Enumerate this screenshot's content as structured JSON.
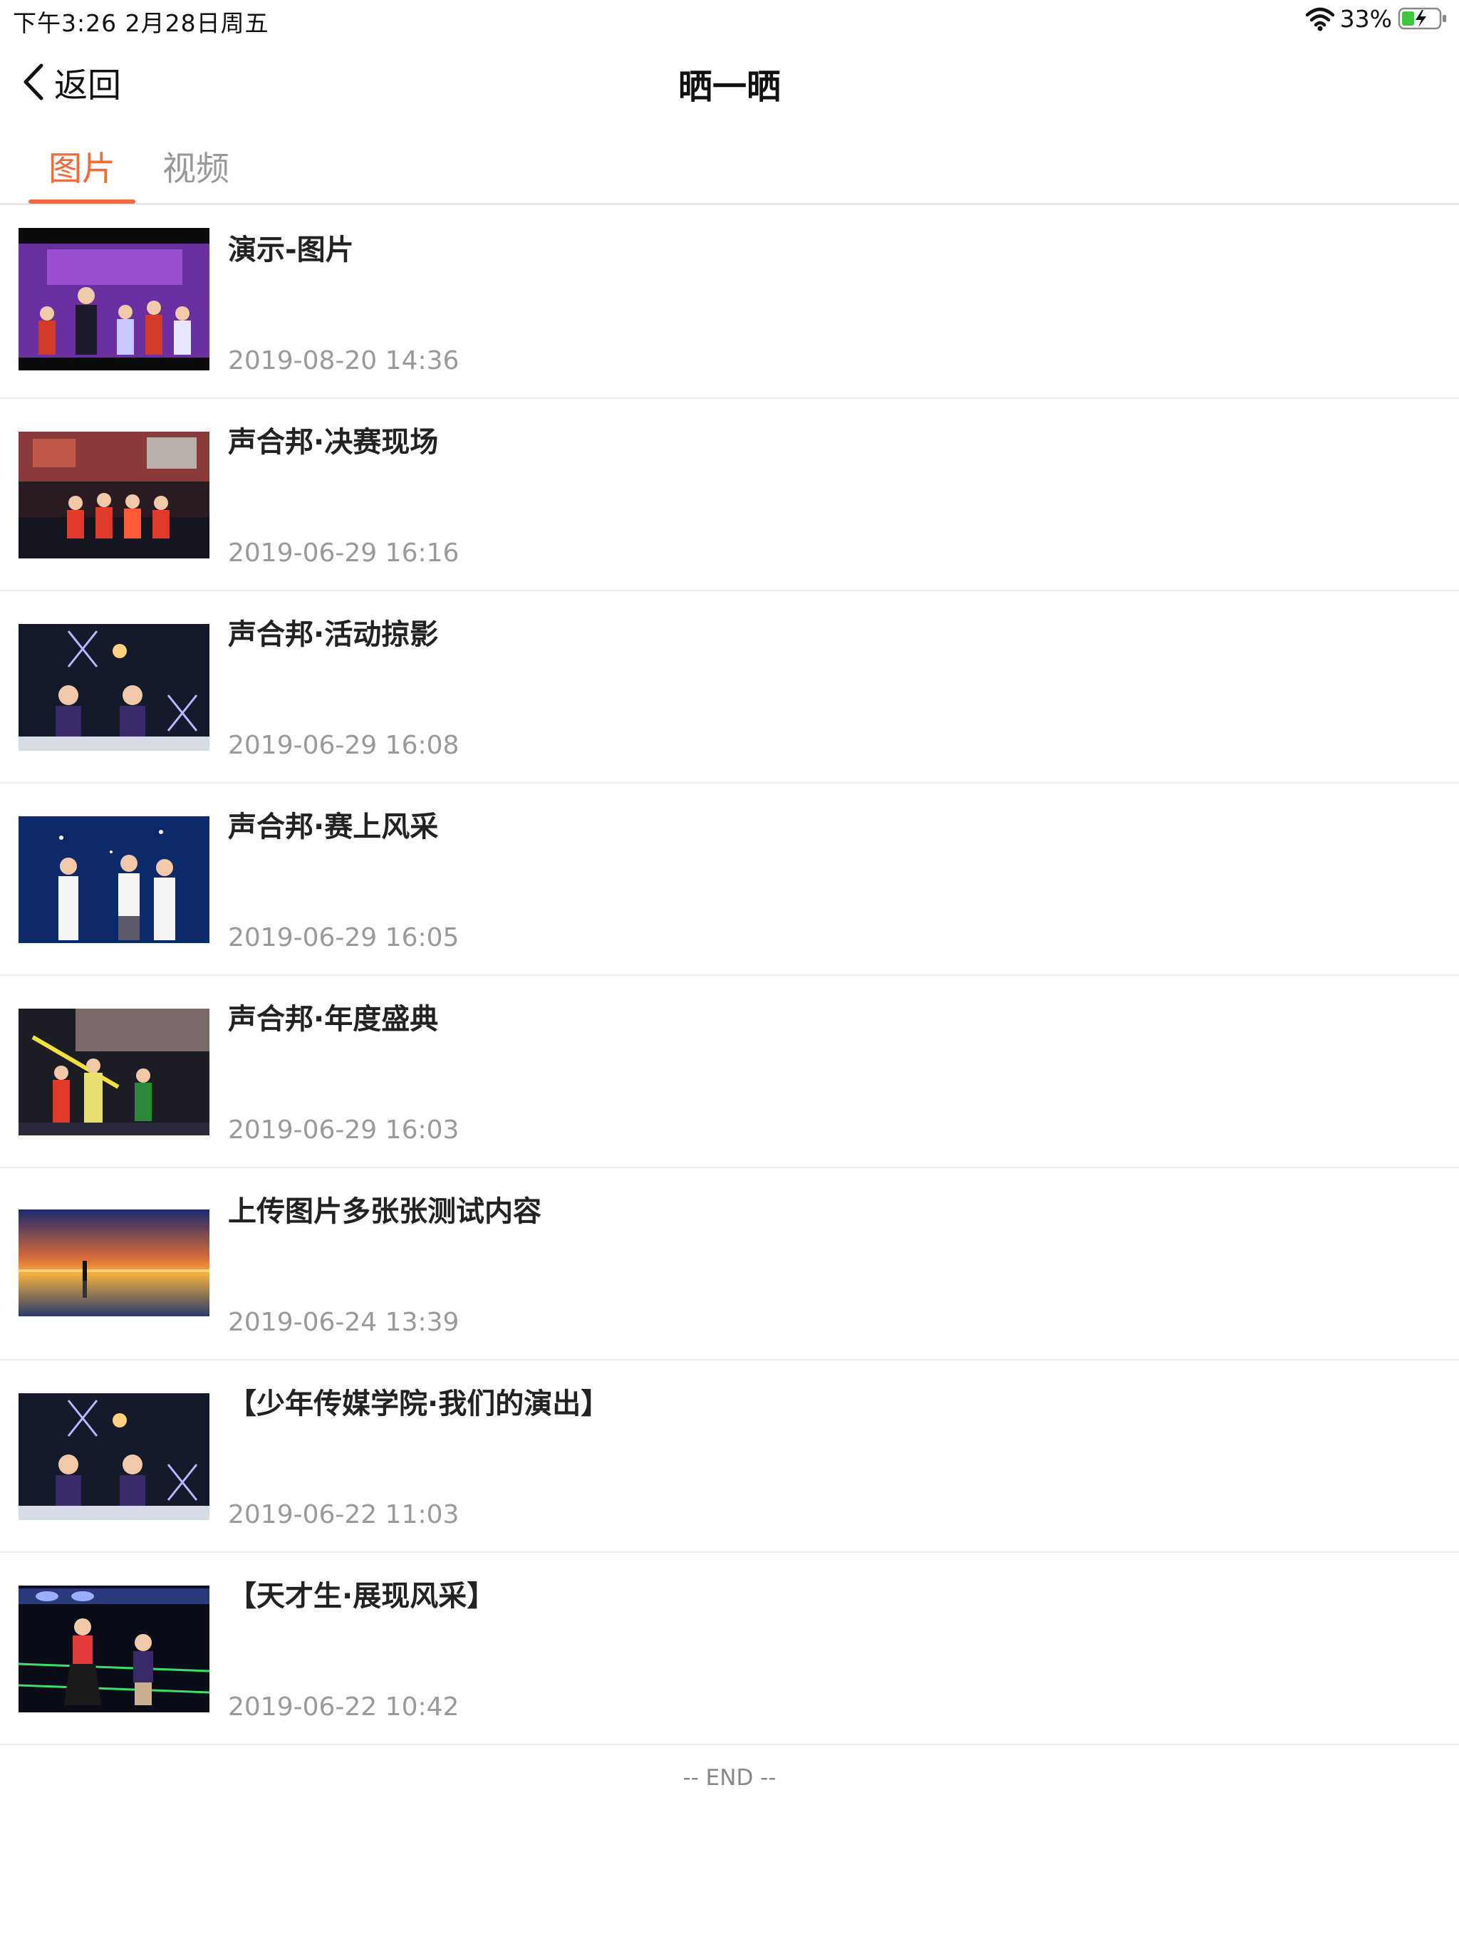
{
  "status_bar": {
    "time_date": "下午3:26   2月28日周五",
    "battery_percent": "33%",
    "battery_level": 0.33,
    "wifi_icon": "wifi-icon",
    "battery_icon": "battery-charging-icon"
  },
  "nav": {
    "back_label": "返回",
    "back_icon": "chevron-left-icon",
    "title": "晒一晒"
  },
  "tabs": [
    {
      "label": "图片",
      "active": true
    },
    {
      "label": "视频",
      "active": false
    }
  ],
  "colors": {
    "accent": "#f26b3a",
    "date_text": "#9a9a9a",
    "divider": "#ececec"
  },
  "items": [
    {
      "title": "演示-图片",
      "date": "2019-08-20 14:36"
    },
    {
      "title": "声合邦·决赛现场",
      "date": "2019-06-29 16:16"
    },
    {
      "title": "声合邦·活动掠影",
      "date": "2019-06-29 16:08"
    },
    {
      "title": "声合邦·赛上风采",
      "date": "2019-06-29 16:05"
    },
    {
      "title": "声合邦·年度盛典",
      "date": "2019-06-29 16:03"
    },
    {
      "title": "上传图片多张张测试内容",
      "date": "2019-06-24 13:39"
    },
    {
      "title": "【少年传媒学院·我们的演出】",
      "date": "2019-06-22 11:03"
    },
    {
      "title": "【天才生·展现风采】",
      "date": "2019-06-22 10:42"
    }
  ],
  "list_end": "-- END --"
}
